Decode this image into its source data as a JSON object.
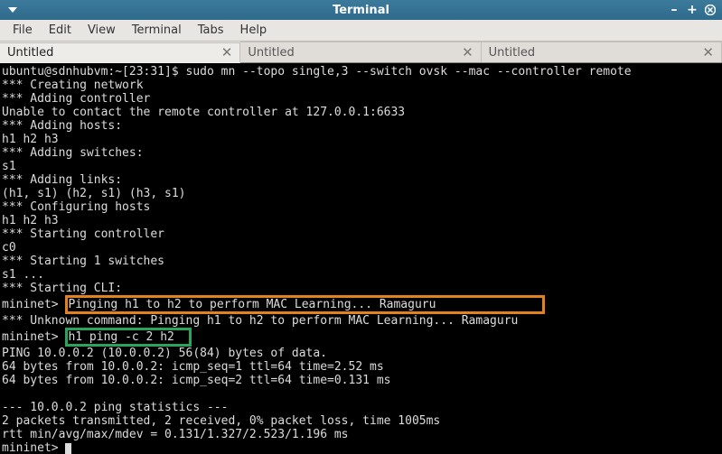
{
  "window": {
    "title": "Terminal"
  },
  "menubar": {
    "file": "File",
    "edit": "Edit",
    "view": "View",
    "terminal": "Terminal",
    "tabs": "Tabs",
    "help": "Help"
  },
  "tabs": [
    {
      "label": "Untitled",
      "active": true
    },
    {
      "label": "Untitled",
      "active": false
    },
    {
      "label": "Untitled",
      "active": false
    }
  ],
  "terminal": {
    "prompt": "ubuntu@sdnhubvm:~[23:31]$ ",
    "command": "sudo mn --topo single,3 --switch ovsk --mac --controller remote",
    "l1": "*** Creating network",
    "l2": "*** Adding controller",
    "l3": "Unable to contact the remote controller at 127.0.0.1:6633",
    "l4": "*** Adding hosts:",
    "l5": "h1 h2 h3 ",
    "l6": "*** Adding switches:",
    "l7": "s1 ",
    "l8": "*** Adding links:",
    "l9": "(h1, s1) (h2, s1) (h3, s1) ",
    "l10": "*** Configuring hosts",
    "l11": "h1 h2 h3 ",
    "l12": "*** Starting controller",
    "l13": "c0 ",
    "l14": "*** Starting 1 switches",
    "l15": "s1 ...",
    "l16": "*** Starting CLI:",
    "mn_prompt1": "mininet> ",
    "orange_text": "Pinging h1 to h2 to perform MAC Learning... Ramaguru               ",
    "l17": "*** Unknown command: Pinging h1 to h2 to perform MAC Learning... Ramaguru",
    "mn_prompt2": "mininet> ",
    "green_text": "h1 ping -c 2 h2  ",
    "l18": "PING 10.0.0.2 (10.0.0.2) 56(84) bytes of data.",
    "l19": "64 bytes from 10.0.0.2: icmp_seq=1 ttl=64 time=2.52 ms",
    "l20": "64 bytes from 10.0.0.2: icmp_seq=2 ttl=64 time=0.131 ms",
    "l21": "",
    "l22": "--- 10.0.0.2 ping statistics ---",
    "l23": "2 packets transmitted, 2 received, 0% packet loss, time 1005ms",
    "l24": "rtt min/avg/max/mdev = 0.131/1.327/2.523/1.196 ms",
    "mn_prompt3": "mininet> "
  }
}
